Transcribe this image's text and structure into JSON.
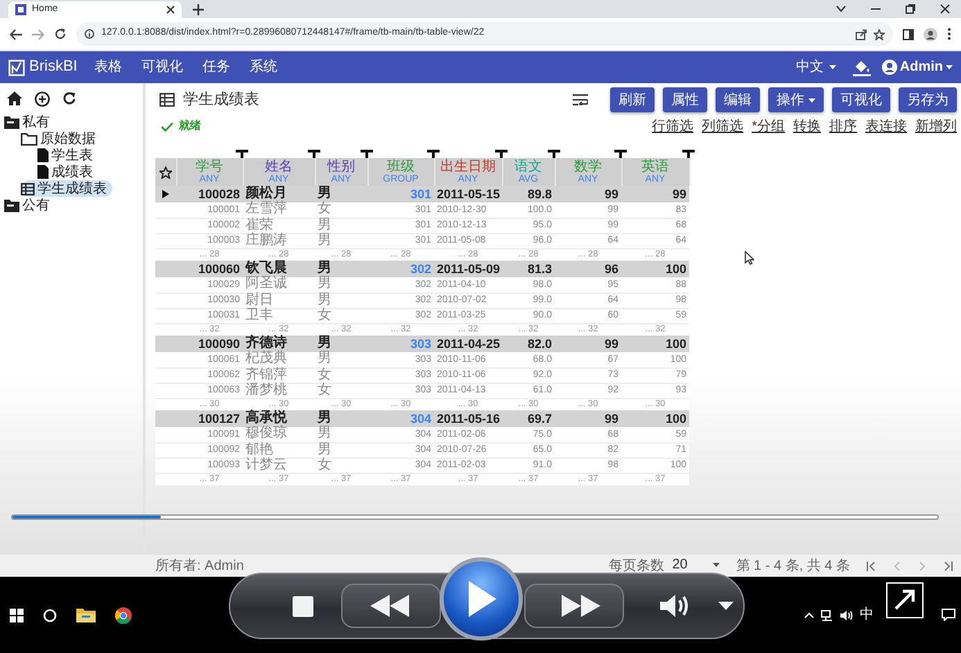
{
  "browser": {
    "tab_title": "Home",
    "url": "127.0.0.1:8088/dist/index.html?r=0.28996080712448147#/frame/tb-main/tb-table-view/22"
  },
  "navbar": {
    "brand": "BriskBI",
    "menu": [
      "表格",
      "可视化",
      "任务",
      "系统"
    ],
    "language": "中文",
    "user": "Admin"
  },
  "sidebar": {
    "tree": [
      {
        "label": "私有",
        "kind": "root",
        "selected": false,
        "children": [
          {
            "label": "原始数据",
            "kind": "folder",
            "selected": false,
            "children": [
              {
                "label": "学生表",
                "kind": "file",
                "selected": false
              },
              {
                "label": "成绩表",
                "kind": "file",
                "selected": false
              }
            ]
          },
          {
            "label": "学生成绩表",
            "kind": "table",
            "selected": true
          }
        ]
      },
      {
        "label": "公有",
        "kind": "root",
        "selected": false
      }
    ]
  },
  "main": {
    "title": "学生成绩表",
    "buttons": [
      {
        "label": "刷新",
        "dropdown": false
      },
      {
        "label": "属性",
        "dropdown": false
      },
      {
        "label": "编辑",
        "dropdown": false
      },
      {
        "label": "操作",
        "dropdown": true
      },
      {
        "label": "可视化",
        "dropdown": false
      },
      {
        "label": "另存为",
        "dropdown": false
      }
    ],
    "links": [
      "行筛选",
      "列筛选",
      "*分组",
      "转换",
      "排序",
      "表连接",
      "新增列"
    ],
    "status": "就绪",
    "table": {
      "columns": [
        {
          "name": "学号",
          "aggregate": "ANY",
          "color": "#2e9a3a",
          "group_by": false
        },
        {
          "name": "姓名",
          "aggregate": "ANY",
          "color": "#5a3db5",
          "group_by": false
        },
        {
          "name": "性别",
          "aggregate": "ANY",
          "color": "#5a3db5",
          "group_by": false
        },
        {
          "name": "班级",
          "aggregate": "GROUP",
          "color": "#2e9a3a",
          "group_by": true
        },
        {
          "name": "出生日期",
          "aggregate": "ANY",
          "color": "#c0392b",
          "group_by": false
        },
        {
          "name": "语文",
          "aggregate": "AVG",
          "color": "#23a094",
          "group_by": false
        },
        {
          "name": "数学",
          "aggregate": "ANY",
          "color": "#2e9a3a",
          "group_by": false
        },
        {
          "name": "英语",
          "aggregate": "ANY",
          "color": "#2e9a3a",
          "group_by": false
        }
      ],
      "groups": [
        {
          "selected": true,
          "row": [
            "100028",
            "颜松月",
            "男",
            "301",
            "2011-05-15",
            "89.8",
            "99",
            "99"
          ],
          "details": [
            [
              "100001",
              "左雪萍",
              "女",
              "301",
              "2010-12-30",
              "100.0",
              "99",
              "83"
            ],
            [
              "100002",
              "崔荣",
              "男",
              "301",
              "2010-12-13",
              "95.0",
              "99",
              "68"
            ],
            [
              "100003",
              "庄鹏涛",
              "男",
              "301",
              "2011-05-08",
              "96.0",
              "64",
              "64"
            ]
          ],
          "summary": [
            "... 28",
            "... 28",
            "... 28",
            "... 28",
            "... 28",
            "... 28",
            "... 28",
            "... 28"
          ]
        },
        {
          "selected": false,
          "row": [
            "100060",
            "钦飞晨",
            "男",
            "302",
            "2011-05-09",
            "81.3",
            "96",
            "100"
          ],
          "details": [
            [
              "100029",
              "阿圣诚",
              "男",
              "302",
              "2011-04-10",
              "98.0",
              "95",
              "88"
            ],
            [
              "100030",
              "尉日",
              "男",
              "302",
              "2010-07-02",
              "99.0",
              "64",
              "98"
            ],
            [
              "100031",
              "卫丰",
              "女",
              "302",
              "2011-03-25",
              "90.0",
              "60",
              "59"
            ]
          ],
          "summary": [
            "... 32",
            "... 32",
            "... 32",
            "... 32",
            "... 32",
            "... 32",
            "... 32",
            "... 32"
          ]
        },
        {
          "selected": false,
          "row": [
            "100090",
            "齐德诗",
            "男",
            "303",
            "2011-04-25",
            "82.0",
            "99",
            "100"
          ],
          "details": [
            [
              "100061",
              "杞茂典",
              "男",
              "303",
              "2010-11-06",
              "68.0",
              "67",
              "100"
            ],
            [
              "100062",
              "齐锦萍",
              "女",
              "303",
              "2010-11-06",
              "92.0",
              "73",
              "79"
            ],
            [
              "100063",
              "潘梦桃",
              "女",
              "303",
              "2011-04-13",
              "61.0",
              "92",
              "93"
            ]
          ],
          "summary": [
            "... 30",
            "... 30",
            "... 30",
            "... 30",
            "... 30",
            "... 30",
            "... 30",
            "... 30"
          ]
        },
        {
          "selected": false,
          "row": [
            "100127",
            "高承悦",
            "男",
            "304",
            "2011-05-16",
            "69.7",
            "99",
            "100"
          ],
          "details": [
            [
              "100091",
              "穆俊琼",
              "男",
              "304",
              "2011-02-06",
              "75.0",
              "68",
              "59"
            ],
            [
              "100092",
              "郁艳",
              "男",
              "304",
              "2010-07-26",
              "65.0",
              "82",
              "71"
            ],
            [
              "100093",
              "计梦云",
              "女",
              "304",
              "2011-02-03",
              "91.0",
              "98",
              "100"
            ]
          ],
          "summary": [
            "... 37",
            "... 37",
            "... 37",
            "... 37",
            "... 37",
            "... 37",
            "... 37",
            "... 37"
          ]
        }
      ]
    }
  },
  "footer": {
    "owner": "所有者: Admin",
    "page_size_label": "每页条数",
    "page_size": "20",
    "range": "第 1 - 4 条, 共 4 条"
  },
  "media_player": {
    "seek": {
      "level": 0.16
    }
  },
  "taskbar": {
    "ime": "中"
  }
}
